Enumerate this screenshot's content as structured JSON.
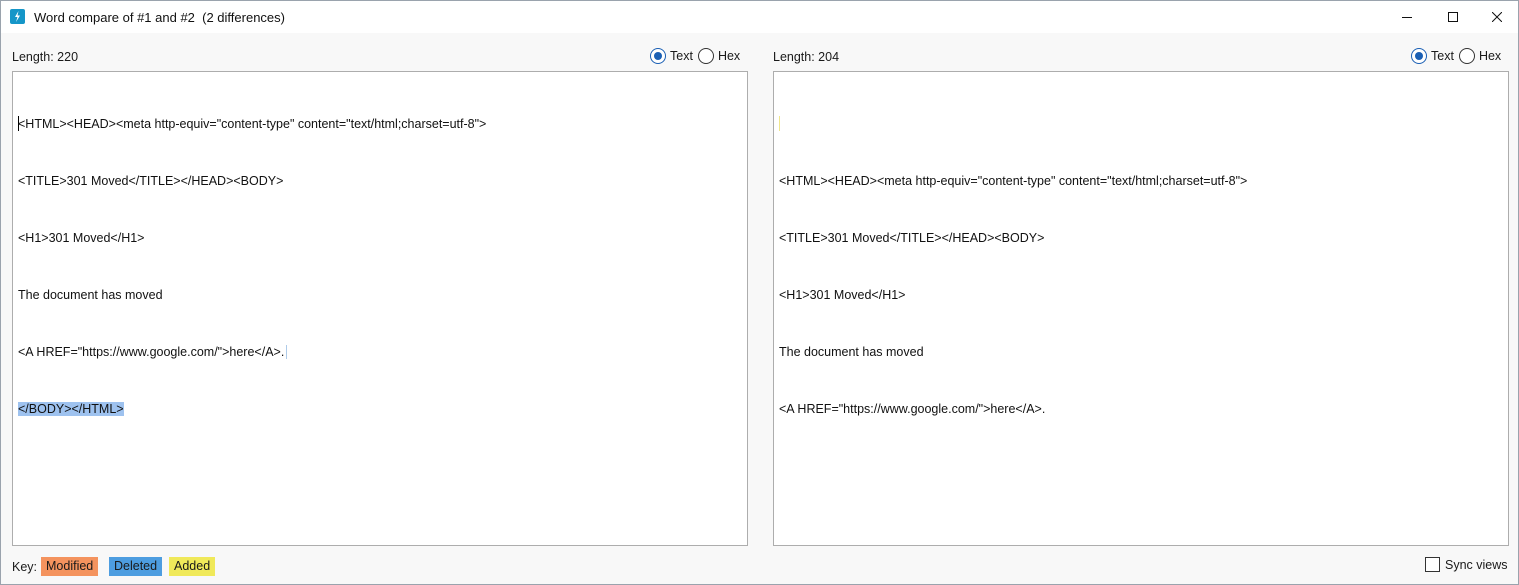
{
  "window": {
    "title": "Word compare of #1 and #2  (2 differences)"
  },
  "left_pane": {
    "length_label": "Length: 220",
    "view_modes": [
      {
        "label": "Text",
        "checked": true
      },
      {
        "label": "Hex",
        "checked": false
      }
    ],
    "lines": [
      "<HTML><HEAD><meta http-equiv=\"content-type\" content=\"text/html;charset=utf-8\">",
      "<TITLE>301 Moved</TITLE></HEAD><BODY>",
      "<H1>301 Moved</H1>",
      "The document has moved",
      "<A HREF=\"https://www.google.com/\">here</A>.",
      "</BODY></HTML>"
    ]
  },
  "right_pane": {
    "length_label": "Length: 204",
    "view_modes": [
      {
        "label": "Text",
        "checked": true
      },
      {
        "label": "Hex",
        "checked": false
      }
    ],
    "lines": [
      "",
      "<HTML><HEAD><meta http-equiv=\"content-type\" content=\"text/html;charset=utf-8\">",
      "<TITLE>301 Moved</TITLE></HEAD><BODY>",
      "<H1>301 Moved</H1>",
      "The document has moved",
      "<A HREF=\"https://www.google.com/\">here</A>."
    ]
  },
  "key": {
    "label": "Key:",
    "modified": "Modified",
    "deleted": "Deleted",
    "added": "Added",
    "colors": {
      "modified": "#f4935e",
      "deleted": "#4d9de0",
      "added": "#f0e95a"
    }
  },
  "sync_views": {
    "label": "Sync views",
    "checked": false
  }
}
